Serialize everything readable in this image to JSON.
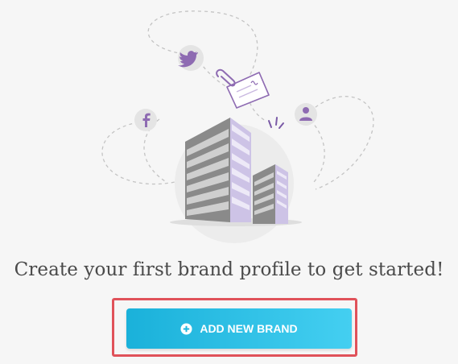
{
  "empty_state": {
    "message": "Create your first brand profile to get started!",
    "add_button_label": "ADD NEW BRAND"
  },
  "illustration": {
    "icons": [
      "twitter-icon",
      "facebook-icon",
      "user-icon",
      "document-icon",
      "paperclip-icon",
      "building-icon"
    ]
  },
  "colors": {
    "accent_purple": "#8e6bb2",
    "button_start": "#1ab1da",
    "button_end": "#44cff1",
    "highlight_border": "#e0525a",
    "background": "#f6f6f6"
  }
}
